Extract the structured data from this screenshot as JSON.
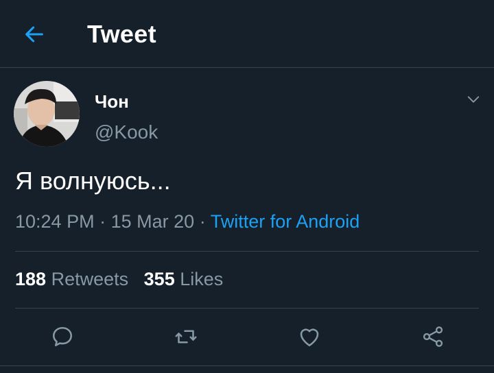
{
  "colors": {
    "background": "#15202b",
    "accent": "#1da1f2",
    "secondary_text": "#8899a6",
    "divider": "#38444d"
  },
  "header": {
    "title": "Tweet",
    "back_icon": "arrow-left-icon"
  },
  "tweet": {
    "display_name": "Чон",
    "handle": "@Kook",
    "text": "Я волнуюсь...",
    "time": "10:24 PM",
    "date": "15 Mar 20",
    "separator": "·",
    "source": "Twitter for Android"
  },
  "stats": {
    "retweets_count": "188",
    "retweets_label": "Retweets",
    "likes_count": "355",
    "likes_label": "Likes"
  },
  "actions": {
    "reply_icon": "reply-icon",
    "retweet_icon": "retweet-icon",
    "like_icon": "heart-icon",
    "share_icon": "share-icon"
  }
}
